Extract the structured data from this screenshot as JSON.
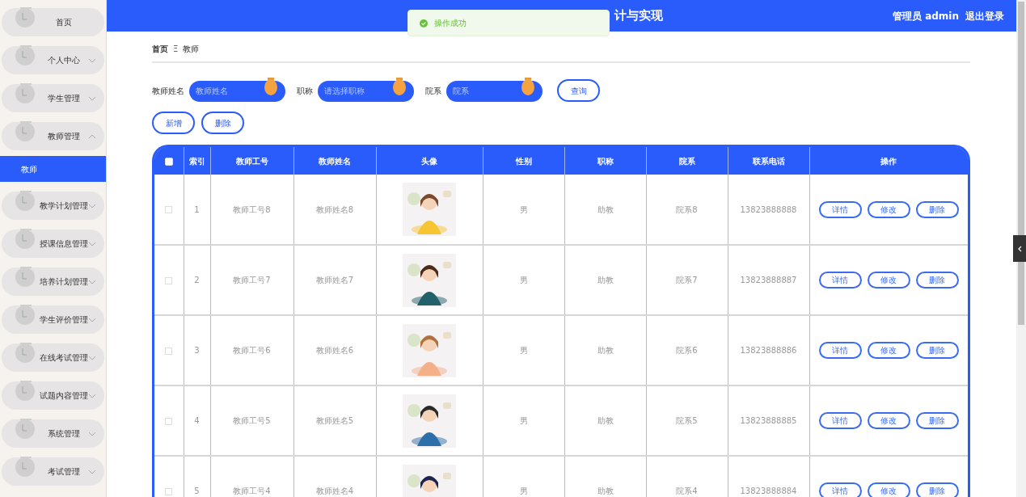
{
  "sidebar": {
    "items": [
      {
        "label": "首页",
        "kind": "link"
      },
      {
        "label": "个人中心",
        "kind": "menu",
        "expanded": false
      },
      {
        "label": "学生管理",
        "kind": "menu",
        "expanded": false
      },
      {
        "label": "教师管理",
        "kind": "menu",
        "expanded": true,
        "children": [
          {
            "label": "教师",
            "selected": true
          }
        ]
      },
      {
        "label": "教学计划管理",
        "kind": "menu",
        "expanded": false
      },
      {
        "label": "授课信息管理",
        "kind": "menu",
        "expanded": false
      },
      {
        "label": "培养计划管理",
        "kind": "menu",
        "expanded": false
      },
      {
        "label": "学生评价管理",
        "kind": "menu",
        "expanded": false
      },
      {
        "label": "在线考试管理",
        "kind": "menu",
        "expanded": false
      },
      {
        "label": "试题内容管理",
        "kind": "menu",
        "expanded": false
      },
      {
        "label": "系统管理",
        "kind": "menu",
        "expanded": false
      },
      {
        "label": "考试管理",
        "kind": "menu",
        "expanded": false
      }
    ]
  },
  "header": {
    "title": "计与实现",
    "user": "管理员 admin",
    "logout": "退出登录"
  },
  "toast": {
    "kind": "success",
    "text": "操作成功"
  },
  "breadcrumb": [
    "首页",
    "教师"
  ],
  "breadcrumb_separator": "Ξ",
  "search": {
    "fields": [
      {
        "label": "教师姓名",
        "placeholder": "教师姓名"
      },
      {
        "label": "职称",
        "placeholder": "请选择职称"
      },
      {
        "label": "院系",
        "placeholder": "院系"
      }
    ],
    "button": "查询"
  },
  "actions": [
    "新增",
    "删除"
  ],
  "table": {
    "select_all": false,
    "columns": [
      "索引",
      "教师工号",
      "教师姓名",
      "头像",
      "性别",
      "职称",
      "院系",
      "联系电话",
      "操作"
    ],
    "rows": [
      {
        "checked": false,
        "cells": [
          "1",
          "教师工号8",
          "教师姓名8",
          {
            "kind": "picture"
          },
          "男",
          "助教",
          "院系8",
          "13823888888"
        ],
        "actions": [
          "详情",
          "修改",
          "删除"
        ]
      },
      {
        "checked": false,
        "cells": [
          "2",
          "教师工号7",
          "教师姓名7",
          {
            "kind": "picture"
          },
          "男",
          "助教",
          "院系7",
          "13823888887"
        ],
        "actions": [
          "详情",
          "修改",
          "删除"
        ]
      },
      {
        "checked": false,
        "cells": [
          "3",
          "教师工号6",
          "教师姓名6",
          {
            "kind": "picture"
          },
          "男",
          "助教",
          "院系6",
          "13823888886"
        ],
        "actions": [
          "详情",
          "修改",
          "删除"
        ]
      },
      {
        "checked": false,
        "cells": [
          "4",
          "教师工号5",
          "教师姓名5",
          {
            "kind": "picture"
          },
          "男",
          "助教",
          "院系5",
          "13823888885"
        ],
        "actions": [
          "详情",
          "修改",
          "删除"
        ]
      },
      {
        "checked": false,
        "cells": [
          "5",
          "教师工号4",
          "教师姓名4",
          {
            "kind": "picture"
          },
          "男",
          "助教",
          "院系4",
          "13823888884"
        ],
        "actions": [
          "详情",
          "修改",
          "删除"
        ]
      }
    ]
  }
}
